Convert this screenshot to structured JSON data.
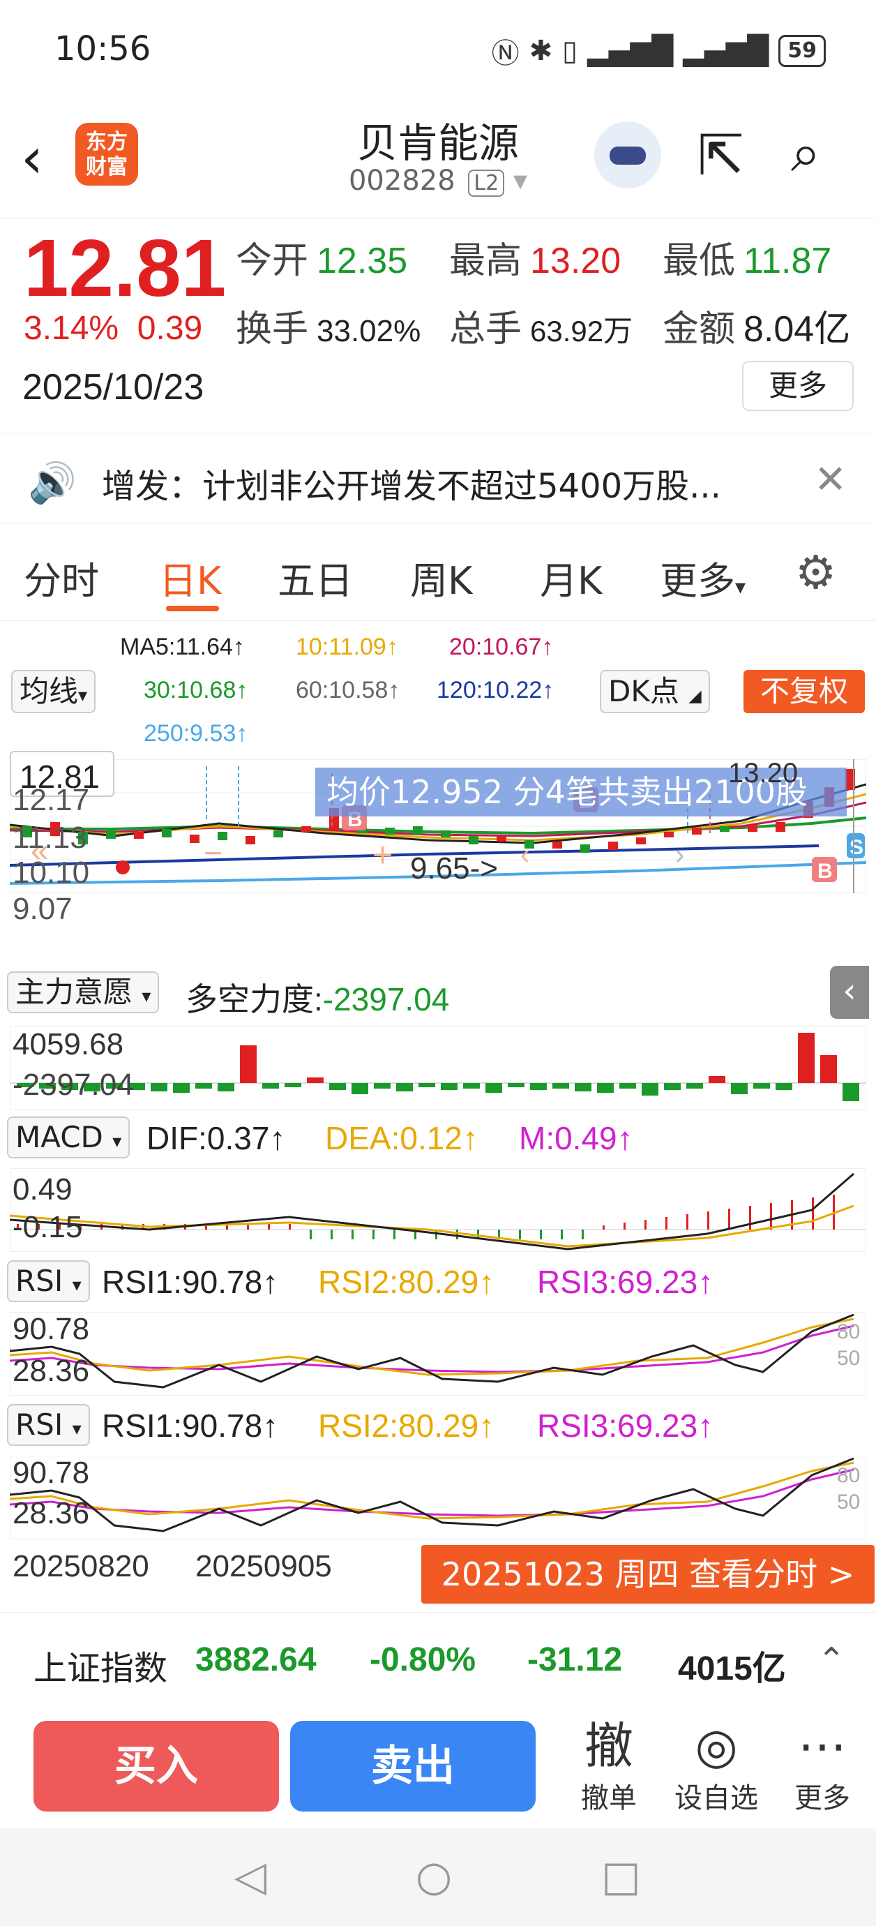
{
  "status": {
    "time": "10:56",
    "battery": "59"
  },
  "header": {
    "name": "贝肯能源",
    "code": "002828",
    "level": "L2",
    "logo_line1": "东方",
    "logo_line2": "财富"
  },
  "quote": {
    "price": "12.81",
    "change_pct": "3.14%",
    "change": "0.39",
    "date": "2025/10/23",
    "open_label": "今开",
    "open": "12.35",
    "high_label": "最高",
    "high": "13.20",
    "low_label": "最低",
    "low": "11.87",
    "turnover_label": "换手",
    "turnover": "33.02%",
    "volume_label": "总手",
    "volume": "63.92万",
    "amount_label": "金额",
    "amount": "8.04亿",
    "more": "更多"
  },
  "notice": {
    "text": "增发：计划非公开增发不超过5400万股..."
  },
  "tabs": [
    "分时",
    "日K",
    "五日",
    "周K",
    "月K",
    "更多"
  ],
  "chart": {
    "ma_dropdown": "均线",
    "ma5": "MA5:11.64↑",
    "ma10": "10:11.09↑",
    "ma20": "20:10.67↑",
    "ma30": "30:10.68↑",
    "ma60": "60:10.58↑",
    "ma120": "120:10.22↑",
    "ma250": "250:9.53↑",
    "dk": "DK点",
    "fq": "不复权",
    "price_top": "12.81",
    "p2": "12.17",
    "p3": "11.13",
    "p4": "10.10",
    "p5": "9.07",
    "tooltip": "均价12.952  分4笔共卖出2100股",
    "top_label": "13.20",
    "low_note": "9.65->",
    "force_dropdown": "主力意愿",
    "force_label": "多空力度:",
    "force_value": "-2397.04",
    "force_max": "4059.68",
    "force_min": "-2397.04",
    "macd_dropdown": "MACD",
    "dif": "DIF:0.37↑",
    "dea": "DEA:0.12↑",
    "m": "M:0.49↑",
    "macd_max": "0.49",
    "macd_min": "-0.15",
    "rsi_dropdown": "RSI",
    "rsi1": "RSI1:90.78↑",
    "rsi2": "RSI2:80.29↑",
    "rsi3": "RSI3:69.23↑",
    "rsi_max": "90.78",
    "rsi_min": "28.36",
    "rsi_80": "80",
    "rsi_50": "50",
    "x1": "20250820",
    "x2": "20250905",
    "view_min": "20251023 周四 查看分时 >"
  },
  "index": {
    "name": "上证指数",
    "value": "3882.64",
    "pct": "-0.80%",
    "chg": "-31.12",
    "amount": "4015亿"
  },
  "actions": {
    "buy": "买入",
    "sell": "卖出",
    "cancel_icon": "撤",
    "cancel": "撤单",
    "fav": "设自选",
    "more": "更多"
  },
  "colors": {
    "accent": "#f15a22",
    "up": "#e02020",
    "down": "#1a9a2a",
    "buy": "#ee5a5a",
    "sell": "#3a86f5"
  }
}
